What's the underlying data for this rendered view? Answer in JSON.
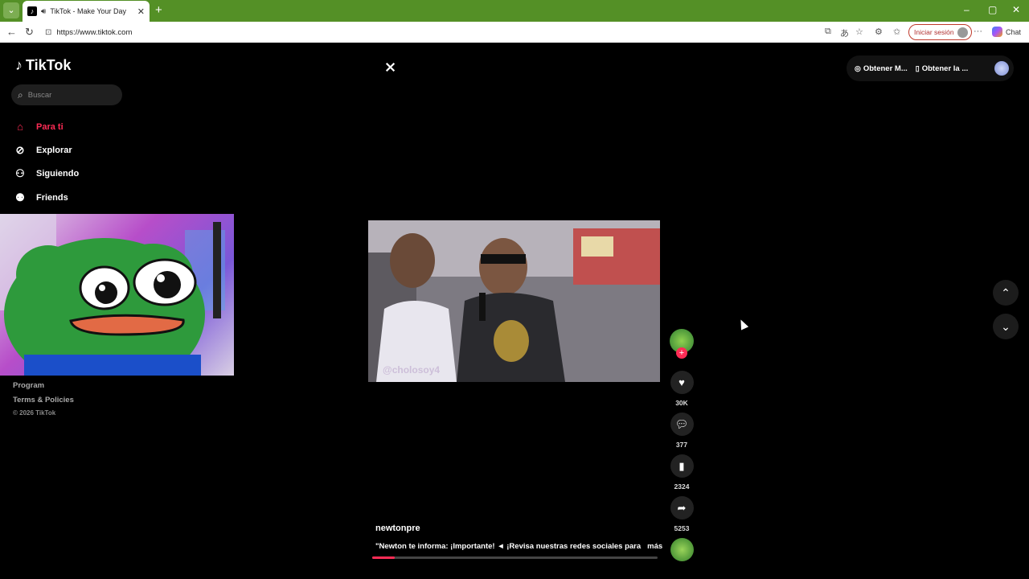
{
  "browser": {
    "tab_title": "TikTok - Make Your Day",
    "url": "https://www.tiktok.com",
    "signin_label": "Iniciar sesión",
    "chat_label": "Chat",
    "icons": [
      "tab-actions-icon",
      "tiktok-favicon-icon",
      "speaker-icon",
      "close-icon",
      "new-tab-icon",
      "back-icon",
      "reload-icon",
      "site-info-icon",
      "open-app-icon",
      "translate-icon",
      "favorite-star-icon",
      "extensions-icon",
      "favorites-icon",
      "profile-icon",
      "more-icon",
      "copilot-icon",
      "minimize-icon",
      "restore-icon",
      "window-close-icon"
    ]
  },
  "sidebar": {
    "brand": "TikTok",
    "search_placeholder": "Buscar",
    "items": [
      {
        "label": "Para ti",
        "icon": "home-icon",
        "active": true
      },
      {
        "label": "Explorar",
        "icon": "compass-icon",
        "active": false
      },
      {
        "label": "Siguiendo",
        "icon": "following-icon",
        "active": false
      },
      {
        "label": "Friends",
        "icon": "friends-icon",
        "active": false
      }
    ],
    "footer": {
      "program": "Program",
      "terms": "Terms & Policies",
      "copyright": "© 2026 TikTok"
    }
  },
  "header": {
    "obtain_coins": "Obtener M...",
    "obtain_app": "Obtener la ..."
  },
  "video": {
    "watermark": "@cholosoy4",
    "author": "newtonpre",
    "caption": "\"Newton te informa: ¡Importante! ◄ ¡Revisa nuestras redes sociales para",
    "more_label": "más",
    "progress": 0.08
  },
  "actions": {
    "likes": "30K",
    "comments": "377",
    "saves": "2324",
    "shares": "5253"
  },
  "colors": {
    "accent": "#fe2c55",
    "tabbar": "#549026",
    "background": "#000000"
  }
}
